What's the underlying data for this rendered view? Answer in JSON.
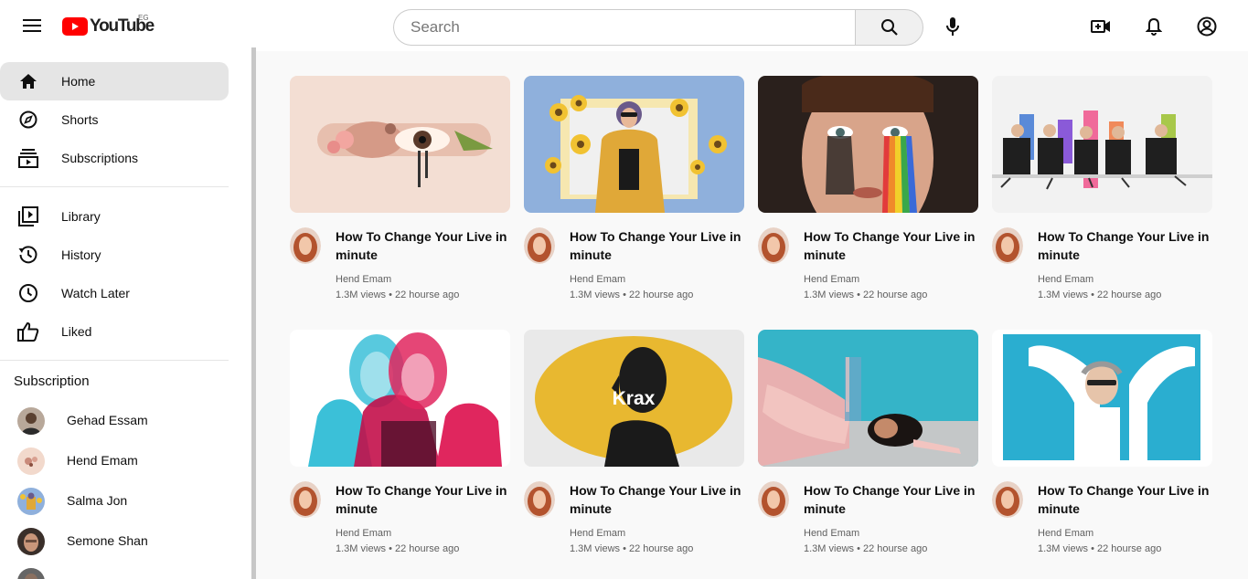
{
  "header": {
    "logo_text": "YouTube",
    "country_code": "EG",
    "search": {
      "placeholder": "Search",
      "value": ""
    },
    "icons": [
      "menu-icon",
      "search-icon",
      "mic-icon",
      "create-video-icon",
      "bell-icon",
      "account-icon"
    ]
  },
  "sidebar": {
    "primary": [
      {
        "label": "Home",
        "icon": "home-icon",
        "active": true
      },
      {
        "label": "Shorts",
        "icon": "shorts-icon"
      },
      {
        "label": "Subscriptions",
        "icon": "subscriptions-icon"
      }
    ],
    "secondary": [
      {
        "label": "Library",
        "icon": "library-icon"
      },
      {
        "label": "History",
        "icon": "history-icon"
      },
      {
        "label": "Watch Later",
        "icon": "watch-later-icon"
      },
      {
        "label": "Liked",
        "icon": "like-icon"
      }
    ],
    "subscription_title": "Subscription",
    "subscriptions": [
      {
        "name": "Gehad Essam"
      },
      {
        "name": "Hend Emam"
      },
      {
        "name": "Salma Jon"
      },
      {
        "name": "Semone Shan"
      }
    ]
  },
  "videos": [
    {
      "title": "How To Change Your Live in minute",
      "channel": "Hend Emam",
      "meta": "1.3M views • 22 hourse ago"
    },
    {
      "title": "How To Change Your Live in minute",
      "channel": "Hend Emam",
      "meta": "1.3M views • 22 hourse ago"
    },
    {
      "title": "How To Change Your Live in minute",
      "channel": "Hend Emam",
      "meta": "1.3M views • 22 hourse ago"
    },
    {
      "title": "How To Change Your Live in minute",
      "channel": "Hend Emam",
      "meta": "1.3M views • 22 hourse ago"
    },
    {
      "title": "How To Change Your Live in minute",
      "channel": "Hend Emam",
      "meta": "1.3M views • 22 hourse ago",
      "thumb_text": ""
    },
    {
      "title": "How To Change Your Live in minute",
      "channel": "Hend Emam",
      "meta": "1.3M views • 22 hourse ago",
      "thumb_text": "Krax"
    },
    {
      "title": "How To Change Your Live in minute",
      "channel": "Hend Emam",
      "meta": "1.3M views • 22 hourse ago"
    },
    {
      "title": "How To Change Your Live in minute",
      "channel": "Hend Emam",
      "meta": "1.3M views • 22 hourse ago"
    }
  ],
  "colors": {
    "brand_red": "#ff0000",
    "active_nav_bg": "#e5e5e5",
    "page_bg": "#f9f9f9",
    "secondary_text": "#606060"
  }
}
